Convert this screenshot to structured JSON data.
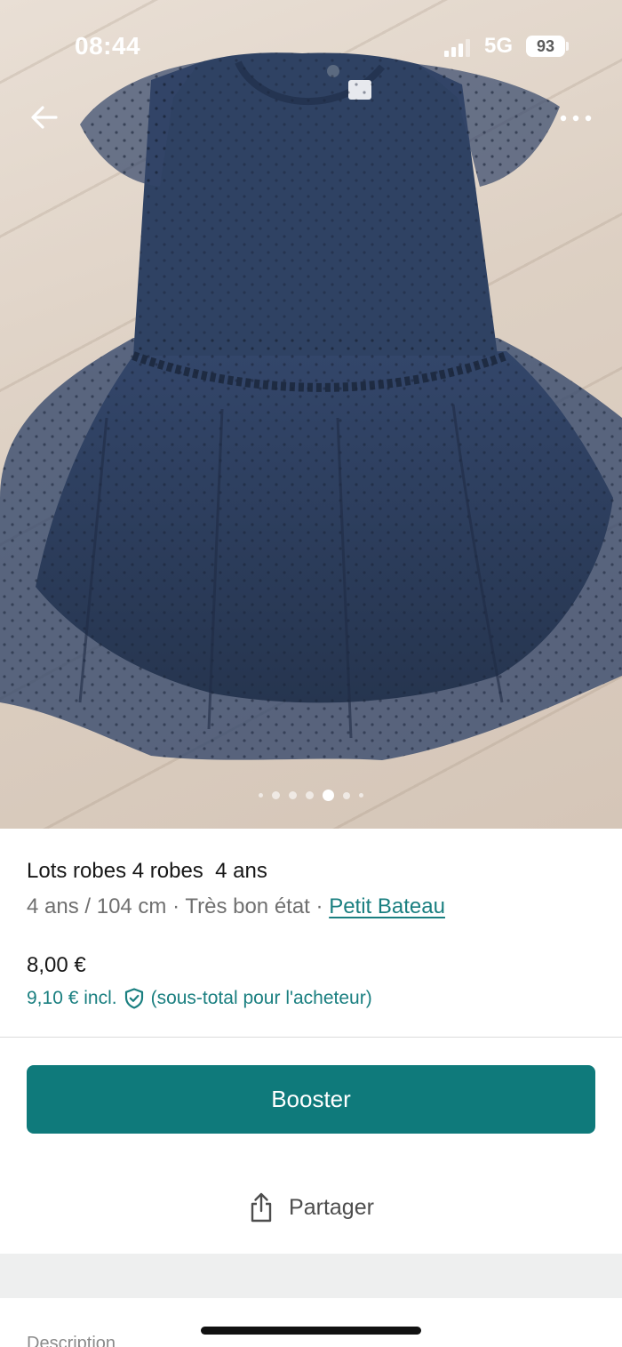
{
  "status_bar": {
    "time": "08:44",
    "network": "5G",
    "battery": "93"
  },
  "navigation": {
    "back_icon": "arrow-left-icon",
    "more_icon": "more-horizontal-icon"
  },
  "gallery": {
    "photo_count": 7,
    "active_index": 4
  },
  "item": {
    "title": "Lots robes 4 robes  4 ans",
    "size": "4 ans / 104 cm",
    "separator": " · ",
    "condition": "Très bon état",
    "brand": "Petit Bateau",
    "price": "8,00 €",
    "total_price": "9,10 € incl.",
    "total_note": "(sous-total pour l'acheteur)",
    "protection_icon": "shield-check-icon"
  },
  "actions": {
    "booster_label": "Booster",
    "share_label": "Partager",
    "share_icon": "share-icon"
  },
  "description": {
    "heading": "Description"
  },
  "colors": {
    "accent": "#0f7a7b",
    "link": "#1a7f80",
    "dress": "#2e3f5c"
  }
}
